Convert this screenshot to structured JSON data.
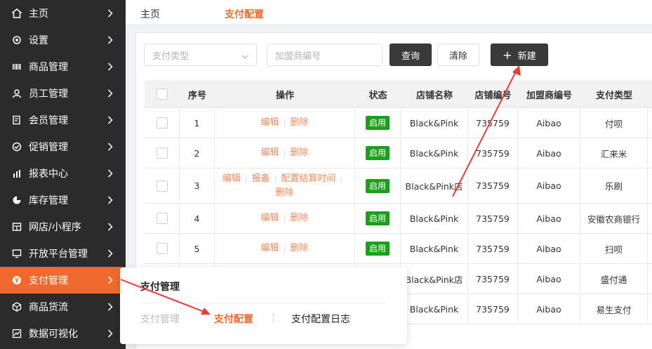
{
  "sidebar": {
    "items": [
      {
        "label": "主页",
        "icon": "home-icon"
      },
      {
        "label": "设置",
        "icon": "gear-icon"
      },
      {
        "label": "商品管理",
        "icon": "barcode-icon"
      },
      {
        "label": "员工管理",
        "icon": "user-icon"
      },
      {
        "label": "会员管理",
        "icon": "member-card-icon"
      },
      {
        "label": "促销管理",
        "icon": "check-circle-icon"
      },
      {
        "label": "报表中心",
        "icon": "bar-chart-icon"
      },
      {
        "label": "库存管理",
        "icon": "pie-chart-icon"
      },
      {
        "label": "网店/小程序",
        "icon": "store-icon"
      },
      {
        "label": "开放平台管理",
        "icon": "monitor-icon"
      },
      {
        "label": "支付管理",
        "icon": "yen-coin-icon",
        "active": true
      },
      {
        "label": "商品货流",
        "icon": "cube-icon"
      },
      {
        "label": "数据可视化",
        "icon": "line-chart-icon"
      }
    ],
    "active_color": "#f06a2e"
  },
  "header": {
    "breadcrumb_home": "主页",
    "breadcrumb_current": "支付配置"
  },
  "filters": {
    "pay_type_placeholder": "支付类型",
    "franchisee_placeholder": "加盟商编号",
    "query_label": "查询",
    "clear_label": "清除",
    "new_label": "新建"
  },
  "table": {
    "columns": [
      "序号",
      "操作",
      "状态",
      "店铺名称",
      "店铺编号",
      "加盟商编号",
      "支付类型"
    ],
    "rows": [
      {
        "index": "1",
        "ops": [
          "编辑",
          "删除"
        ],
        "status": "启用",
        "store_name": "Black&Pink",
        "store_no": "735759",
        "franchisee": "Aibao",
        "pay_type": "付呗"
      },
      {
        "index": "2",
        "ops": [
          "编辑",
          "删除"
        ],
        "status": "启用",
        "store_name": "Black&Pink",
        "store_no": "735759",
        "franchisee": "Aibao",
        "pay_type": "汇来米"
      },
      {
        "index": "3",
        "ops": [
          "编辑",
          "报备",
          "配置结算时间",
          "删除"
        ],
        "status": "启用",
        "store_name": "Black&Pink店",
        "store_no": "735759",
        "franchisee": "Aibao",
        "pay_type": "乐刷"
      },
      {
        "index": "4",
        "ops": [
          "编辑",
          "删除"
        ],
        "status": "启用",
        "store_name": "Black&Pink",
        "store_no": "735759",
        "franchisee": "Aibao",
        "pay_type": "安徽农商银行"
      },
      {
        "index": "5",
        "ops": [
          "编辑",
          "删除"
        ],
        "status": "启用",
        "store_name": "Black&Pink",
        "store_no": "735759",
        "franchisee": "Aibao",
        "pay_type": "扫呗"
      },
      {
        "index": "",
        "ops": [],
        "status": "",
        "store_name": "Black&Pink店",
        "store_no": "735759",
        "franchisee": "Aibao",
        "pay_type": "盛付通"
      },
      {
        "index": "",
        "ops": [],
        "status": "",
        "store_name": "Black&Pink",
        "store_no": "735759",
        "franchisee": "Aibao",
        "pay_type": "易生支付"
      }
    ],
    "status_color": "#1aa01a",
    "op_color": "#f06a2e"
  },
  "popup": {
    "title": "支付管理",
    "links": [
      "支付管理",
      "支付配置",
      "支付配置日志"
    ]
  }
}
